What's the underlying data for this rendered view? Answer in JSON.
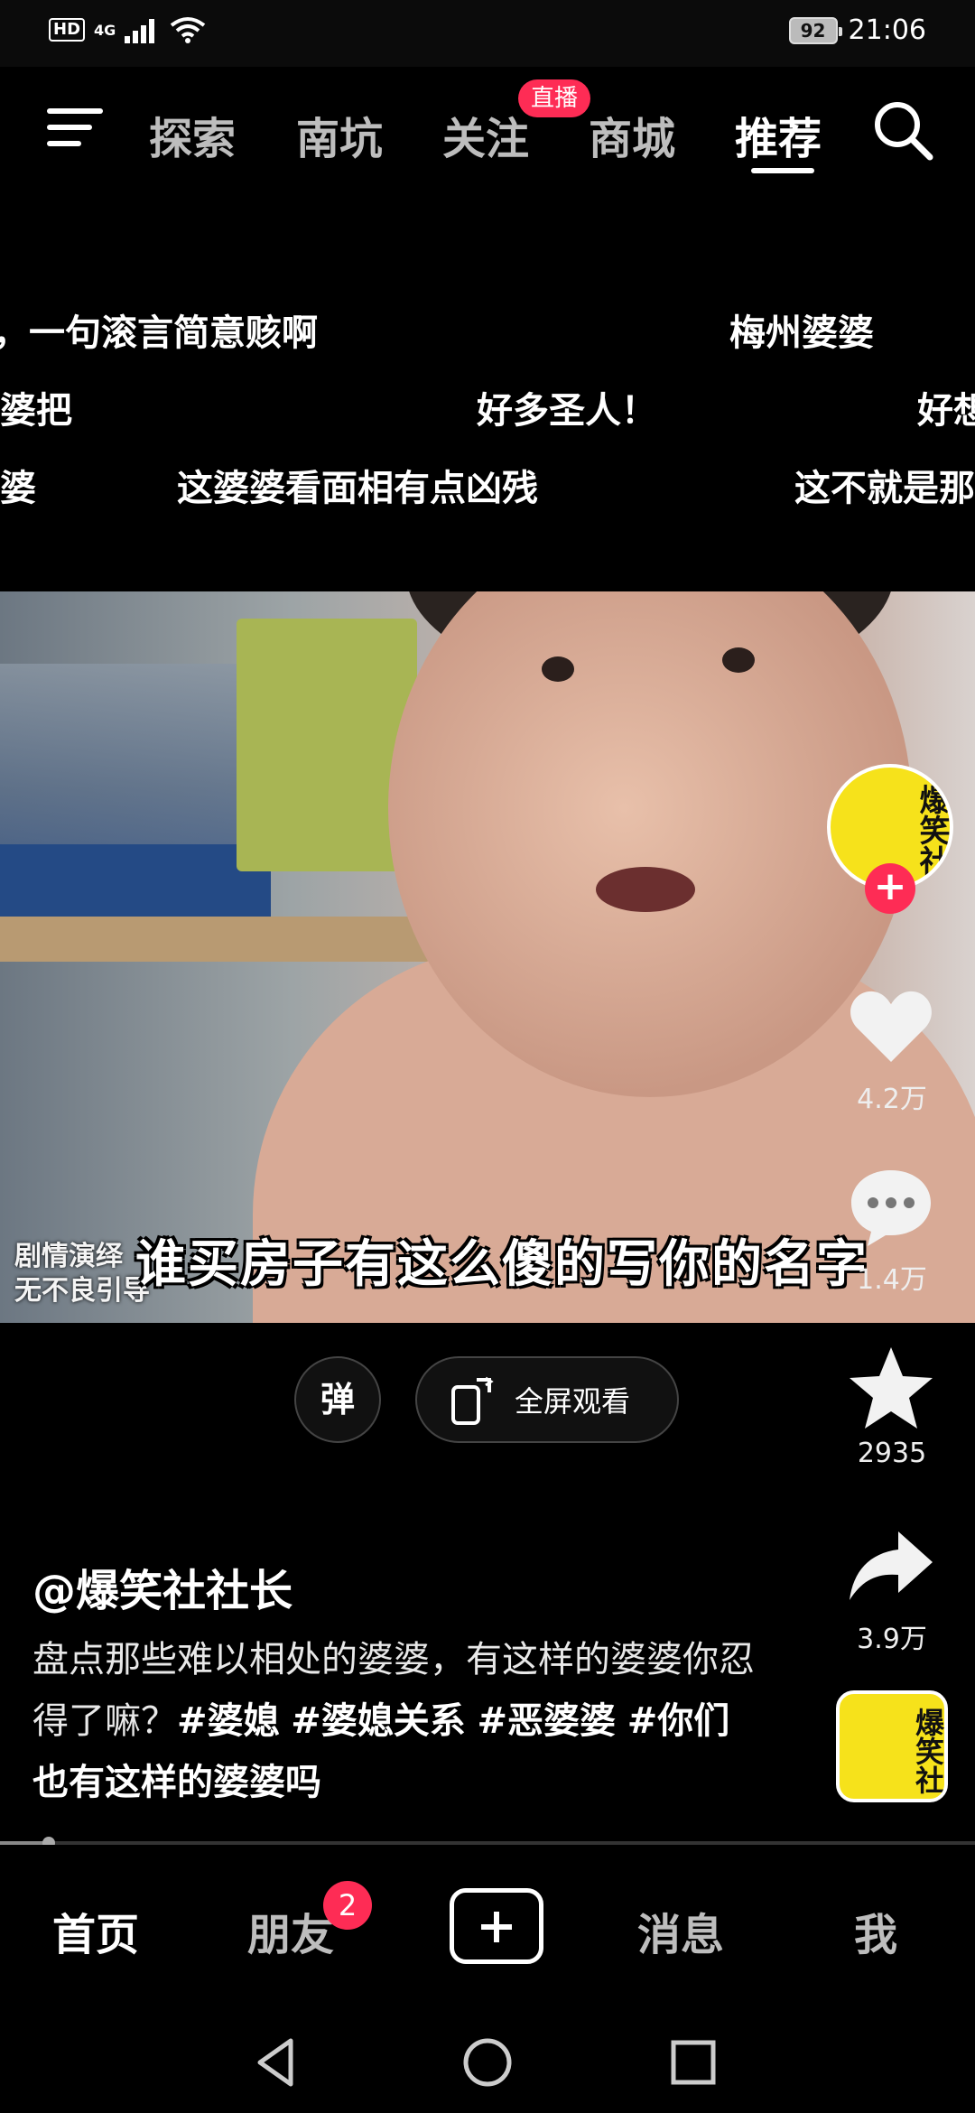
{
  "status_bar": {
    "network_hd": "HD",
    "network_type": "4G",
    "battery": "92",
    "time": "21:06"
  },
  "top_nav": {
    "tabs": [
      {
        "label": "探索",
        "active": false
      },
      {
        "label": "南坑",
        "active": false
      },
      {
        "label": "关注",
        "active": false
      },
      {
        "label": "商城",
        "active": false
      },
      {
        "label": "推荐",
        "active": true
      }
    ],
    "live_badge": "直播"
  },
  "danmaku": [
    {
      "text": "，一句滚言简意赅啊"
    },
    {
      "text": "梅州婆婆"
    },
    {
      "text": "婆把"
    },
    {
      "text": "好多圣人！"
    },
    {
      "text": "好想"
    },
    {
      "text": "婆"
    },
    {
      "text": "这婆婆看面相有点凶残"
    },
    {
      "text": "这不就是那"
    }
  ],
  "video": {
    "subtitle": "谁买房子有这么傻的写你的名字",
    "watermark_line1": "剧情演绎",
    "watermark_line2": "无不良引导"
  },
  "actions": {
    "avatar_text": "爆笑社",
    "likes": "4.2万",
    "comments": "1.4万",
    "favorites": "2935",
    "shares": "3.9万",
    "music_disc_text": "爆笑社"
  },
  "player_controls": {
    "danmu_label": "弹",
    "fullscreen_label": "全屏观看"
  },
  "post": {
    "author": "@爆笑社社长",
    "description": "盘点那些难以相处的婆婆，有这样的婆婆你忍得了嘛？",
    "tags": [
      "#婆媳",
      "#婆媳关系",
      "#恶婆婆",
      "#你们也有这样的婆婆吗"
    ]
  },
  "progress": {
    "fraction": 0.05
  },
  "bottom_nav": {
    "items": [
      {
        "label": "首页",
        "active": true
      },
      {
        "label": "朋友",
        "active": false
      },
      {
        "label": "消息",
        "active": false
      },
      {
        "label": "我",
        "active": false
      }
    ],
    "friends_badge": "2"
  },
  "colors": {
    "accent": "#fe2c55",
    "background": "#000000",
    "avatar_bg": "#f6e21b"
  }
}
